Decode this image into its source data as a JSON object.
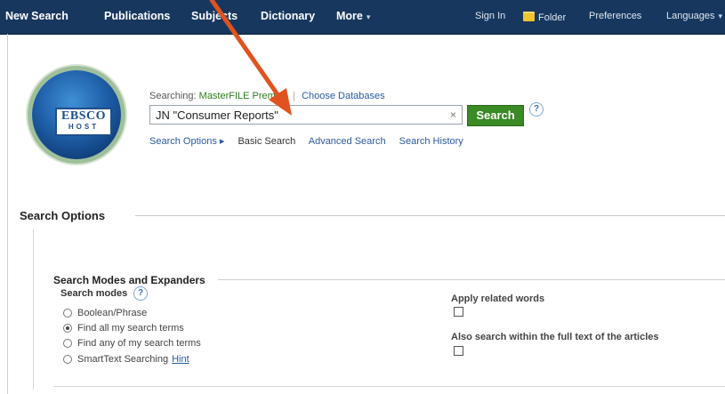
{
  "topnav": {
    "items": [
      "New Search",
      "Publications",
      "Subjects",
      "Dictionary",
      "More"
    ],
    "right_items": [
      "Sign In",
      "Folder",
      "Preferences",
      "Languages"
    ]
  },
  "logo": {
    "line1": "EBSCO",
    "line2": "HOST"
  },
  "search": {
    "searching_label": "Searching:",
    "database": "MasterFILE Premier",
    "choose_databases": "Choose Databases",
    "query": "JN \"Consumer Reports\"",
    "clear": "×",
    "button": "Search",
    "help": "?"
  },
  "links": {
    "search_options": "Search Options ▸",
    "basic": "Basic Search",
    "advanced": "Advanced Search",
    "history": "Search History"
  },
  "options": {
    "title": "Search Options",
    "modes_title": "Search Modes and Expanders",
    "modes_label": "Search modes",
    "help": "?",
    "modes": [
      "Boolean/Phrase",
      "Find all my search terms",
      "Find any of my search terms",
      "SmartText Searching"
    ],
    "selected_mode": "Find all my search terms",
    "hint": "Hint",
    "apply_related": "Apply related words",
    "full_text": "Also search within the full text of the articles"
  },
  "colors": {
    "nav_bg": "#17375e",
    "search_button": "#3a8a25",
    "link": "#2a5aa0",
    "arrow": "#e0521f"
  }
}
